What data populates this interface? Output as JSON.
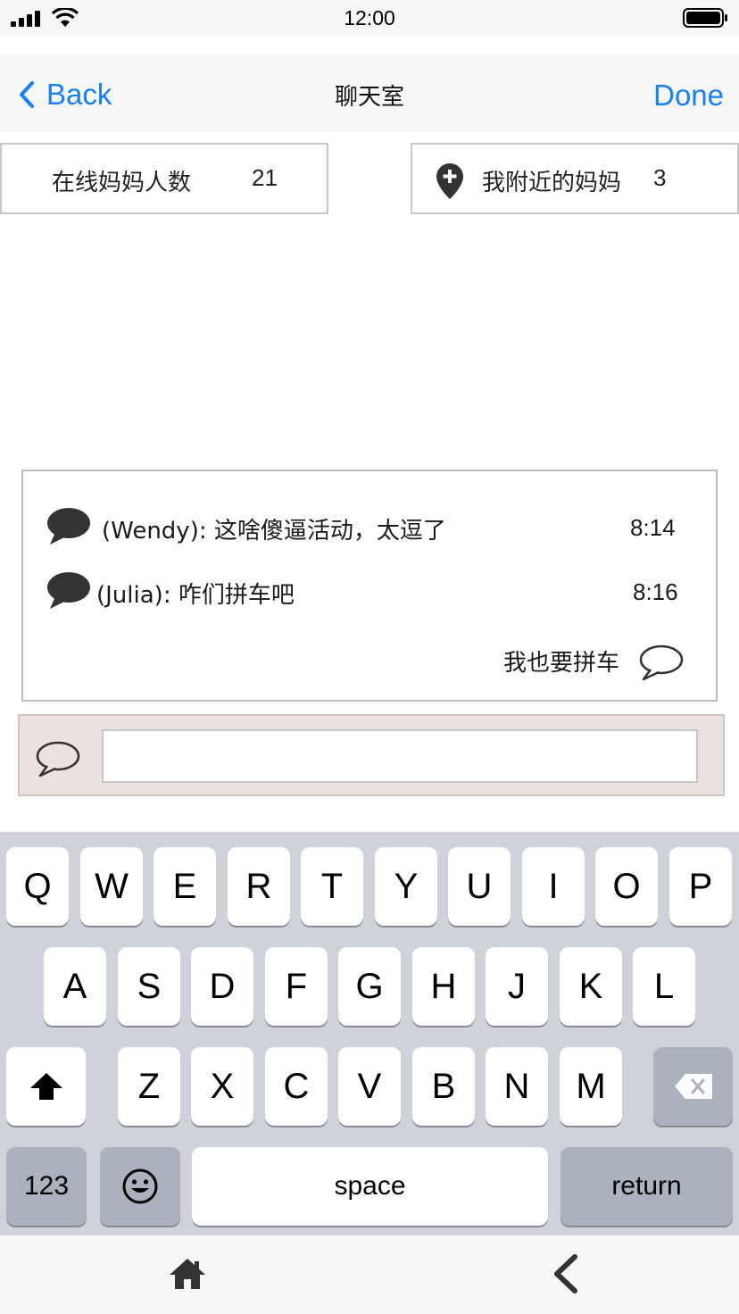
{
  "status_bar": {
    "time": "12:00",
    "icons": [
      "signal-icon",
      "wifi-icon",
      "battery-icon"
    ]
  },
  "nav": {
    "back_label": "Back",
    "title": "聊天室",
    "done_label": "Done",
    "accent_color": "#1a7ff0"
  },
  "stats": {
    "online_label": "在线妈妈人数",
    "online_count": "21",
    "nearby_label": "我附近的妈妈",
    "nearby_count": "3",
    "nearby_icon": "map-pin-plus-icon"
  },
  "chat": {
    "messages": [
      {
        "sender_text": "(Wendy): 这啥傻逼活动，太逗了",
        "time": "8:14",
        "icon": "chat-bubble-filled-icon"
      },
      {
        "sender_text": "(Julia): 咋们拼车吧",
        "time": "8:16",
        "icon": "chat-bubble-filled-icon"
      }
    ],
    "own_message": {
      "text": "我也要拼车",
      "icon": "chat-bubble-outline-icon"
    }
  },
  "composer": {
    "icon": "chat-bubble-outline-icon",
    "value": "",
    "placeholder": "",
    "background": "#ebe1df"
  },
  "keyboard": {
    "row1": [
      "Q",
      "W",
      "E",
      "R",
      "T",
      "Y",
      "U",
      "I",
      "O",
      "P"
    ],
    "row2": [
      "A",
      "S",
      "D",
      "F",
      "G",
      "H",
      "J",
      "K",
      "L"
    ],
    "row3": [
      "Z",
      "X",
      "C",
      "V",
      "B",
      "N",
      "M"
    ],
    "numbers_label": "123",
    "space_label": "space",
    "return_label": "return",
    "shift_icon": "shift-arrow-icon",
    "delete_icon": "backspace-icon",
    "emoji_icon": "emoji-smiley-icon"
  },
  "bottom_bar": {
    "icons": [
      "home-icon",
      "chevron-left-icon"
    ]
  }
}
